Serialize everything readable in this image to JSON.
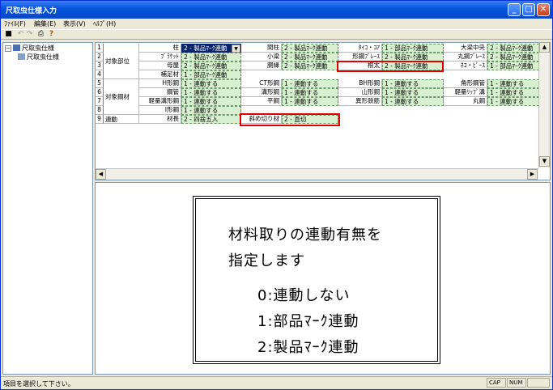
{
  "window": {
    "title": "尺取虫仕様入力"
  },
  "menu": [
    "ﾌｧｲﾙ(F)",
    "編集(E)",
    "表示(V)",
    "ﾍﾙﾌﾟ(H)"
  ],
  "tree": {
    "root": "尺取虫仕様",
    "child": "尺取虫仕様"
  },
  "grid": {
    "rows": [
      {
        "num": "1",
        "cells": [
          {
            "label": "柱",
            "value": "2 - 製品ﾏｰｸ連動",
            "selected": true
          },
          {
            "label": "間柱",
            "value": "2 - 製品ﾏｰｸ連動"
          },
          {
            "label": "ﾀｲｺ・ｺｱ",
            "value": "1 - 部品ﾏｰｸ連動"
          },
          {
            "label": "大梁中央",
            "value": "2 - 製品ﾏｰｸ連動"
          }
        ]
      },
      {
        "num": "2",
        "cells": [
          {
            "label": "ﾌﾞﾗｹｯﾄ",
            "value": "2 - 製品ﾏｰｸ連動"
          },
          {
            "label": "小梁",
            "value": "2 - 製品ﾏｰｸ連動"
          },
          {
            "label": "形鋼ﾌﾞﾚｰｽ",
            "value": "2 - 製品ﾏｰｸ連動"
          },
          {
            "label": "丸鋼ﾌﾞﾚｰｽ",
            "value": "2 - 製品ﾏｰｸ連動"
          }
        ]
      },
      {
        "num": "3",
        "cells": [
          {
            "label": "母屋",
            "value": "2 - 製品ﾏｰｸ連動"
          },
          {
            "label": "胴縁",
            "value": "2 - 製品ﾏｰｸ連動"
          },
          {
            "label": "根太",
            "value": "2 - 製品ﾏｰｸ連動"
          },
          {
            "label": "ﾈｺ・ﾋﾟｰｽ",
            "value": "1 - 部品ﾏｰｸ連動"
          }
        ]
      },
      {
        "num": "4",
        "cells": [
          {
            "label": "補足材",
            "value": "1 - 部品ﾏｰｸ連動"
          }
        ]
      },
      {
        "num": "5",
        "cells": [
          {
            "label": "H形鋼",
            "value": "1 - 連動する"
          },
          {
            "label": "CT形鋼",
            "value": "1 - 連動する"
          },
          {
            "label": "BH形鋼",
            "value": "1 - 連動する"
          },
          {
            "label": "角形鋼管",
            "value": "1 - 連動する"
          }
        ]
      },
      {
        "num": "6",
        "cells": [
          {
            "label": "鋼管",
            "value": "1 - 連動する"
          },
          {
            "label": "溝形鋼",
            "value": "1 - 連動する"
          },
          {
            "label": "山形鋼",
            "value": "1 - 連動する"
          },
          {
            "label": "軽量ﾘｯﾌﾟ溝",
            "value": "1 - 連動する"
          }
        ]
      },
      {
        "num": "7",
        "cells": [
          {
            "label": "軽量溝形鋼",
            "value": "1 - 連動する"
          },
          {
            "label": "平鋼",
            "value": "1 - 連動する"
          },
          {
            "label": "異形鉄筋",
            "value": "1 - 連動する"
          },
          {
            "label": "丸鋼",
            "value": "1 - 連動する"
          }
        ]
      },
      {
        "num": "8",
        "cells": [
          {
            "label": "I形鋼",
            "value": "1 - 連動する"
          }
        ]
      },
      {
        "num": "9",
        "cells": [
          {
            "label": "材長",
            "value": "2 - 四捨五入"
          },
          {
            "label": "斜め切り材",
            "value": "2 - 直切"
          }
        ]
      }
    ],
    "groups": {
      "parts": "対象部位",
      "steel": "対象鋼材",
      "linkage": "連動"
    }
  },
  "help": {
    "line1": "材料取りの連動有無を",
    "line2": "指定します",
    "line3": "0:連動しない",
    "line4": "1:部品ﾏｰｸ連動",
    "line5": "2:製品ﾏｰｸ連動"
  },
  "status": {
    "text": "項目を選択して下さい。",
    "cap": "CAP",
    "num": "NUM"
  }
}
